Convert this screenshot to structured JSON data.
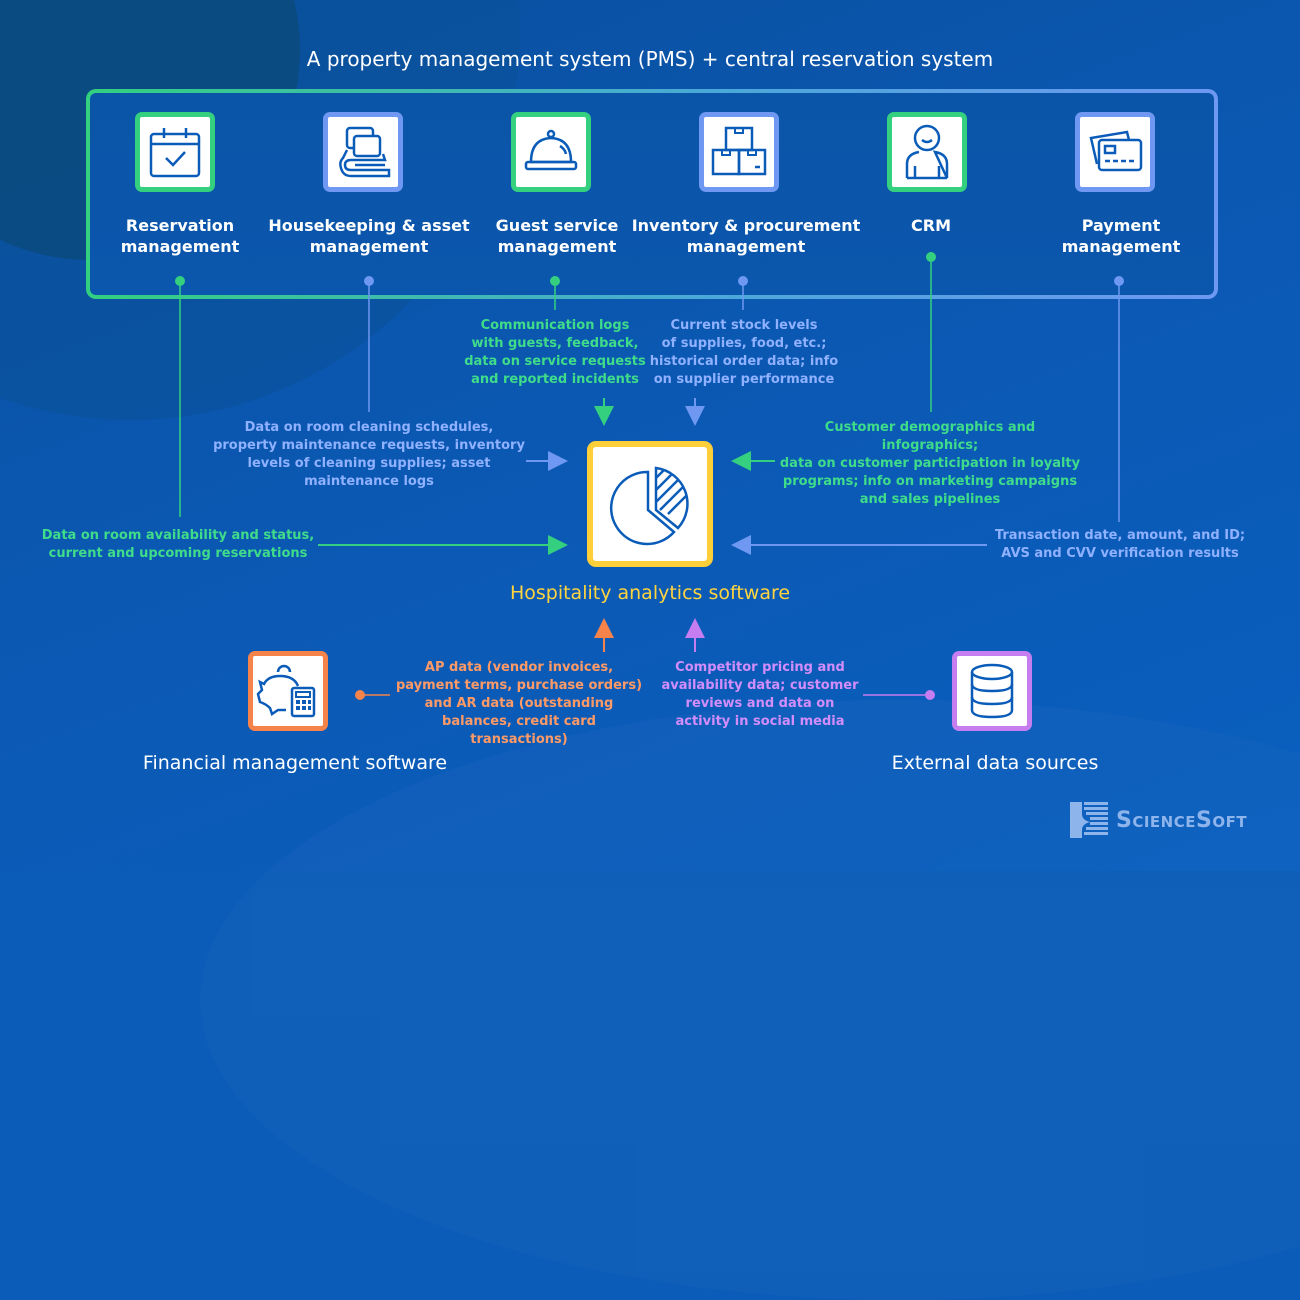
{
  "title": "A property management system (PMS) + central reservation system",
  "colors": {
    "green": "#35d07f",
    "blue": "#6e98f2",
    "yellow": "#ffcf3a",
    "orange": "#f5834a",
    "purple": "#c57df0",
    "background": "#0a5cb8"
  },
  "modules": [
    {
      "label_line1": "Reservation",
      "label_line2": "management",
      "icon": "calendar-check-icon",
      "color": "green"
    },
    {
      "label_line1": "Housekeeping & asset",
      "label_line2": "management",
      "icon": "bed-pillows-icon",
      "color": "blue"
    },
    {
      "label_line1": "Guest service",
      "label_line2": "management",
      "icon": "service-bell-icon",
      "color": "green"
    },
    {
      "label_line1": "Inventory & procurement",
      "label_line2": "management",
      "icon": "boxes-icon",
      "color": "blue"
    },
    {
      "label_line1": "CRM",
      "label_line2": "",
      "icon": "person-icon",
      "color": "green"
    },
    {
      "label_line1": "Payment",
      "label_line2": "management",
      "icon": "credit-cards-icon",
      "color": "blue"
    }
  ],
  "notes": {
    "guest_service": [
      "Communication logs",
      "with guests, feedback,",
      "data on service requests",
      "and reported incidents"
    ],
    "inventory": [
      "Current stock levels",
      "of supplies, food, etc.;",
      "historical order data; info",
      "on supplier performance"
    ],
    "housekeeping": [
      "Data on room cleaning schedules,",
      "property maintenance requests, inventory",
      "levels of cleaning supplies; asset",
      "maintenance logs"
    ],
    "crm": [
      "Customer demographics and infographics;",
      "data on customer participation in loyalty",
      "programs; info on marketing campaigns",
      "and sales pipelines"
    ],
    "reservation": [
      "Data on room availability and status,",
      "current and upcoming reservations"
    ],
    "payment": [
      "Transaction date, amount, and ID;",
      "AVS and CVV verification results"
    ],
    "financial": [
      "AP data (vendor invoices,",
      "payment terms, purchase orders)",
      "and AR data (outstanding",
      "balances, credit card transactions)"
    ],
    "external": [
      "Competitor pricing and",
      "availability data; customer",
      "reviews and data on",
      "activity in social media"
    ]
  },
  "center": {
    "label": "Hospitality analytics software",
    "icon": "pie-chart-icon"
  },
  "financial": {
    "label": "Financial management software",
    "icon": "piggy-bank-calculator-icon"
  },
  "external": {
    "label": "External data sources",
    "icon": "database-icon"
  },
  "logo": {
    "text": "ScienceSoft",
    "icon": "sciencesoft-logo-icon"
  }
}
